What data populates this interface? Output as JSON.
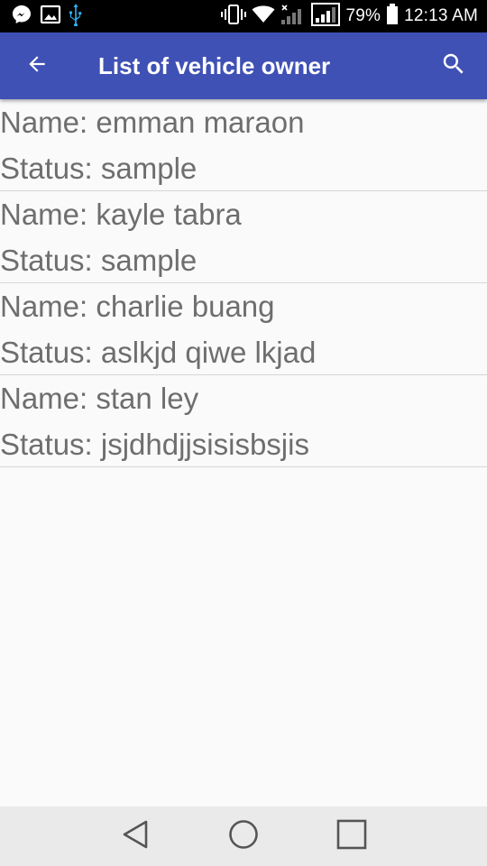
{
  "status_bar": {
    "icons_left": [
      "messenger-icon",
      "gallery-icon",
      "usb-icon"
    ],
    "icons_right": [
      "vibrate-icon",
      "wifi-icon",
      "signal-no-sim-icon",
      "signal-icon"
    ],
    "battery_percent": "79%",
    "time": "12:13 AM"
  },
  "app_bar": {
    "title": "List of vehicle owner",
    "back_icon": "arrow-back-icon",
    "search_icon": "search-icon",
    "color": "#3f51b5"
  },
  "owners": [
    {
      "name": "Name: emman maraon",
      "status": "Status: sample"
    },
    {
      "name": "Name: kayle tabra",
      "status": "Status: sample"
    },
    {
      "name": "Name: charlie buang",
      "status": "Status: aslkjd qiwe lkjad"
    },
    {
      "name": "Name: stan ley",
      "status": "Status: jsjdhdjjsisisbsjis"
    }
  ],
  "nav_bar": {
    "icons": [
      "back-triangle-icon",
      "home-circle-icon",
      "recents-square-icon"
    ]
  }
}
